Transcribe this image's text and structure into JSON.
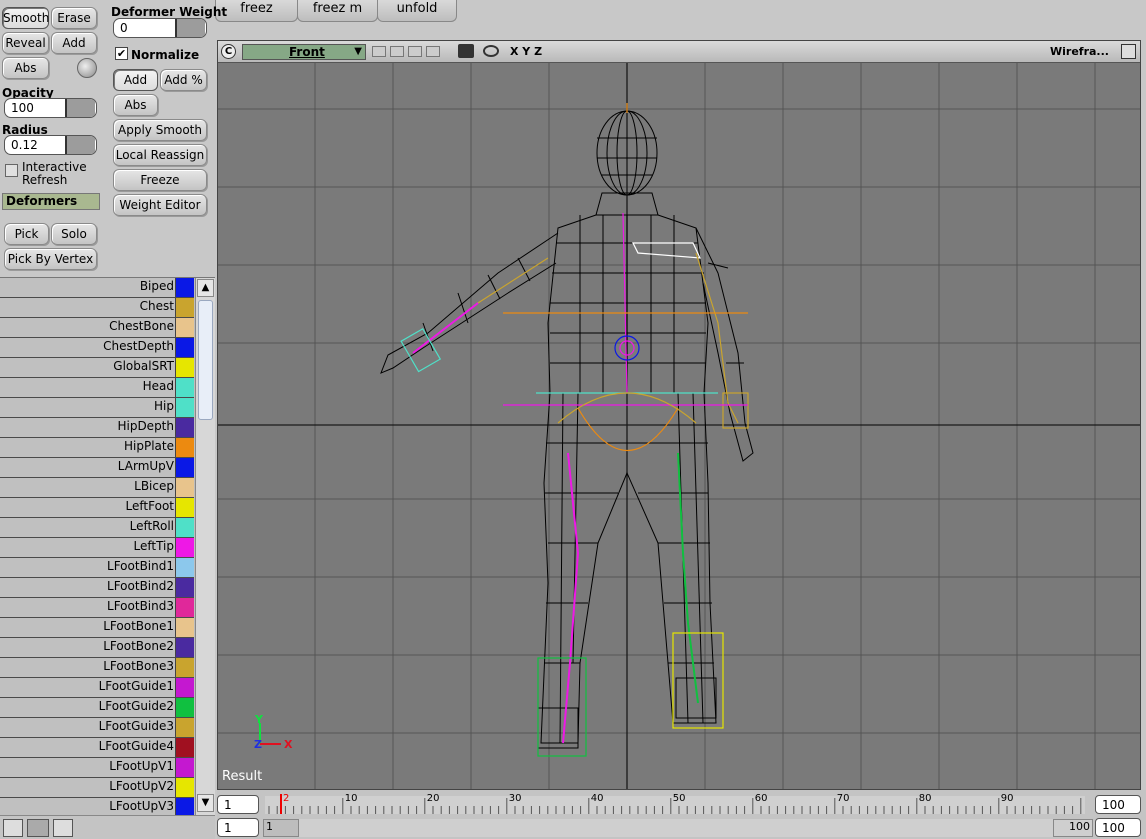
{
  "top_buttons": [
    "freez",
    "freez m",
    "unfold"
  ],
  "tool_buttons": {
    "smooth": "Smooth",
    "erase": "Erase",
    "reveal": "Reveal",
    "add": "Add",
    "abs": "Abs"
  },
  "opacity": {
    "label": "Opacity",
    "value": "100"
  },
  "radius": {
    "label": "Radius",
    "value": "0.12"
  },
  "interactive_refresh": {
    "line1": "Interactive",
    "line2": "Refresh",
    "checked": false
  },
  "deformers_header": "Deformers",
  "pick_buttons": {
    "pick": "Pick",
    "solo": "Solo",
    "pick_by_vertex": "Pick By Vertex"
  },
  "deformer_weight": {
    "label": "Deformer Weight",
    "value": "0"
  },
  "normalize": {
    "label": "Normalize",
    "checked": true
  },
  "mode_buttons": {
    "add": "Add",
    "add_pct": "Add %",
    "abs": "Abs"
  },
  "action_buttons": [
    "Apply Smooth",
    "Local Reassign",
    "Freeze",
    "Weight Editor"
  ],
  "viewport": {
    "view_name": "Front",
    "axes_label": "X Y Z",
    "display_mode": "Wirefra...",
    "result_label": "Result",
    "axis_y": "Y",
    "axis_x": "X",
    "axis_z": "Z"
  },
  "deformers": [
    {
      "name": "Biped",
      "color": "#0a18e6"
    },
    {
      "name": "Chest",
      "color": "#c9a42e"
    },
    {
      "name": "ChestBone",
      "color": "#e8c48c"
    },
    {
      "name": "ChestDepth",
      "color": "#0a18e6"
    },
    {
      "name": "GlobalSRT",
      "color": "#e6e600"
    },
    {
      "name": "Head",
      "color": "#4fe0c8"
    },
    {
      "name": "Hip",
      "color": "#4fe0c8"
    },
    {
      "name": "HipDepth",
      "color": "#4a2aa0"
    },
    {
      "name": "HipPlate",
      "color": "#ec8a10"
    },
    {
      "name": "LArmUpV",
      "color": "#0a18e6"
    },
    {
      "name": "LBicep",
      "color": "#e8c48c"
    },
    {
      "name": "LeftFoot",
      "color": "#e6e600"
    },
    {
      "name": "LeftRoll",
      "color": "#4fe0c8"
    },
    {
      "name": "LeftTip",
      "color": "#ee18e6"
    },
    {
      "name": "LFootBind1",
      "color": "#8cc8ec"
    },
    {
      "name": "LFootBind2",
      "color": "#4a2aa0"
    },
    {
      "name": "LFootBind3",
      "color": "#e0289a"
    },
    {
      "name": "LFootBone1",
      "color": "#e8c48c"
    },
    {
      "name": "LFootBone2",
      "color": "#4a2aa0"
    },
    {
      "name": "LFootBone3",
      "color": "#c9a42e"
    },
    {
      "name": "LFootGuide1",
      "color": "#c418d0"
    },
    {
      "name": "LFootGuide2",
      "color": "#10c040"
    },
    {
      "name": "LFootGuide3",
      "color": "#c9a42e"
    },
    {
      "name": "LFootGuide4",
      "color": "#a01020"
    },
    {
      "name": "LFootUpV1",
      "color": "#c418d0"
    },
    {
      "name": "LFootUpV2",
      "color": "#e6e600"
    },
    {
      "name": "LFootUpV3",
      "color": "#0a18e6"
    }
  ],
  "timeline": {
    "start": "1",
    "end": "100",
    "current_frame": "2",
    "range_start": "1",
    "range_label_start": "1",
    "range_label_end": "100",
    "range_end": "100",
    "ticks": [
      "10",
      "20",
      "30",
      "40",
      "50",
      "60",
      "70",
      "80",
      "90"
    ]
  }
}
